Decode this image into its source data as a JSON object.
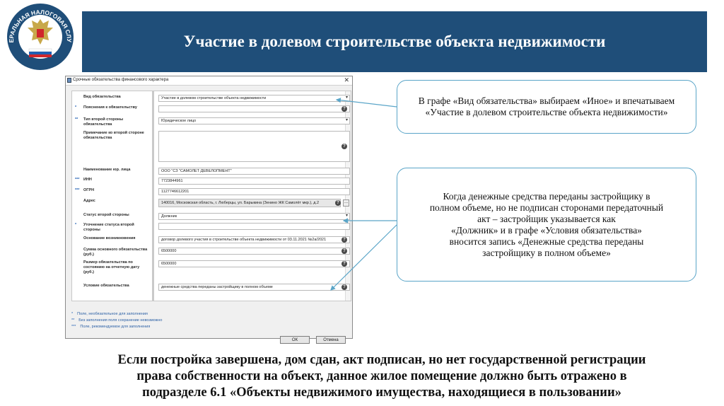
{
  "header": {
    "title": "Участие в долевом строительстве объекта недвижимости"
  },
  "emblem": {
    "text": "ФЕДЕРАЛЬНАЯ НАЛОГОВАЯ СЛУЖБА",
    "colors": {
      "blue": "#1f4e79",
      "gold": "#c8a84a",
      "red": "#d0262b"
    }
  },
  "dialog": {
    "title": "Срочные обязательства финансового характера",
    "fields": [
      {
        "star": "",
        "label": "Вид обязательства",
        "value": "Участие в долевом строительстве объекта недвижимости",
        "type": "select"
      },
      {
        "star": "*",
        "label": "Пояснения к обязательству",
        "value": "",
        "type": "text-q"
      },
      {
        "star": "**",
        "label": "Тип второй стороны обязательства",
        "value": "Юридическое лицо",
        "type": "select"
      },
      {
        "star": "",
        "label": "Примечание ко второй стороне обязательства",
        "value": "",
        "type": "textarea"
      },
      {
        "star": "",
        "label": "Наименование юр. лица",
        "value": "ООО \"СЗ \"САМОЛЕТ ДЕВЕЛОПМЕНТ\"",
        "type": "text"
      },
      {
        "star": "***",
        "label": "ИНН",
        "value": "7723844961",
        "type": "text"
      },
      {
        "star": "***",
        "label": "ОГРН",
        "value": "1127746612201",
        "type": "text"
      },
      {
        "star": "",
        "label": "Адрес",
        "value": "140016, Московская область, г. Люберцы, ул. Барыкина (Зенино ЖК Самолёт мкр.), д.2",
        "type": "address"
      },
      {
        "star": "",
        "label": "Статус второй стороны",
        "value": "Должник",
        "type": "select"
      },
      {
        "star": "*",
        "label": "Уточнение статуса второй стороны",
        "value": "",
        "type": "text"
      },
      {
        "star": "",
        "label": "Основание возникновения",
        "value": "договор долевого участия в строительстве объекта недвижимости от 03.11.2021 №2а/2021",
        "type": "text-q"
      },
      {
        "star": "",
        "label": "Сумма основного обязательства (руб.)",
        "value": "6500000",
        "type": "text-q"
      },
      {
        "star": "",
        "label": "Размер обязательства по состоянию на отчетную дату (руб.)",
        "value": "6500000",
        "type": "text-q"
      },
      {
        "star": "",
        "label": "Условие обязательства",
        "value": "денежные средства переданы застройщику в полном объеме",
        "type": "text-q"
      }
    ],
    "legend": [
      {
        "star": "*",
        "text": "Поле, необязательное для заполнения"
      },
      {
        "star": "**",
        "text": "Без заполнения поля сохранение невозможно"
      },
      {
        "star": "***",
        "text": "Поле, рекомендуемое для заполнения"
      }
    ],
    "ok_label": "ОК",
    "cancel_label": "Отмена",
    "browse_label": "..."
  },
  "callouts": {
    "first": "В графе «Вид обязательства» выбираем «Иное» и впечатываем «Участие в долевом строительстве объекта недвижимости»",
    "second_lines": [
      "Когда денежные средства переданы застройщику в",
      "полном объеме, но не подписан сторонами передаточный",
      "акт – застройщик указывается как",
      "«Должник» и в графе «Условия обязательства»",
      "вносится запись «Денежные средства переданы",
      "застройщику в полном объеме»"
    ]
  },
  "bottom_lines": [
    "Если постройка завершена, дом сдан, акт подписан, но нет государственной регистрации",
    "права собственности на объект, данное жилое помещение должно быть отражено в",
    "подразделе 6.1 «Объекты недвижимого имущества, находящиеся в пользовании»"
  ],
  "colors": {
    "header_bg": "#1f4e79",
    "callout_border": "#5aa5c8",
    "legend_text": "#1f5fb3"
  }
}
